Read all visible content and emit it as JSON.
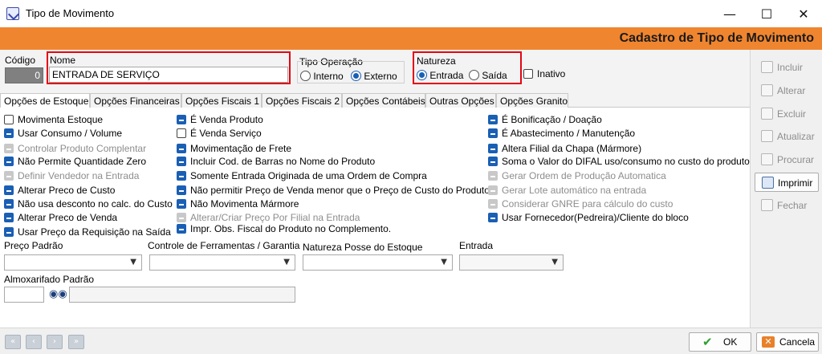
{
  "window": {
    "title": "Tipo de Movimento",
    "minimize": "—",
    "maximize": "☐",
    "close": "✕"
  },
  "header": {
    "title": "Cadastro de Tipo de Movimento"
  },
  "form": {
    "codigo_label": "Código",
    "codigo_value": "0",
    "nome_label": "Nome",
    "nome_value": "ENTRADA DE SERVIÇO",
    "tipo_operacao_label": "Tipo Operação",
    "interno": "Interno",
    "externo": "Externo",
    "natureza_label": "Natureza",
    "entrada": "Entrada",
    "saida": "Saída",
    "inativo": "Inativo"
  },
  "tabs": [
    "Opções de Estoque",
    "Opções Financeiras",
    "Opções Fiscais 1",
    "Opções Fiscais 2",
    "Opções Contábeis",
    "Outras Opções",
    "Opções Granito"
  ],
  "options_col1": [
    {
      "label": "Movimenta Estoque",
      "state": "unchecked"
    },
    {
      "label": "Usar Consumo / Volume",
      "state": "checked"
    },
    {
      "label": "Controlar Produto Complentar",
      "state": "disabled"
    },
    {
      "label": "Não Permite Quantidade Zero",
      "state": "checked"
    },
    {
      "label": "Definir Vendedor na Entrada",
      "state": "disabled"
    },
    {
      "label": "Alterar Preco de Custo",
      "state": "checked"
    },
    {
      "label": "Não usa desconto no calc. do Custo",
      "state": "checked"
    },
    {
      "label": "Alterar Preco de Venda",
      "state": "checked"
    },
    {
      "label": "Usar Preço da Requisição na Saída",
      "state": "checked"
    }
  ],
  "options_col2": [
    {
      "label": "É Venda Produto",
      "state": "checked"
    },
    {
      "label": "É Venda Serviço",
      "state": "unchecked"
    },
    {
      "label": "Movimentação de Frete",
      "state": "checked"
    },
    {
      "label": "Incluir Cod. de Barras no Nome do Produto",
      "state": "checked"
    },
    {
      "label": "Somente Entrada Originada de uma Ordem de Compra",
      "state": "checked"
    },
    {
      "label": "Não permitir Preço de Venda menor que o Preço de Custo do Produto",
      "state": "checked"
    },
    {
      "label": "Não Movimenta Mármore",
      "state": "checked"
    },
    {
      "label": "Alterar/Criar Preço Por Filial na Entrada",
      "state": "disabled"
    },
    {
      "label": "Impr. Obs. Fiscal do Produto no Complemento.",
      "state": "checked"
    }
  ],
  "options_col3": [
    {
      "label": "É Bonificação / Doação",
      "state": "checked"
    },
    {
      "label": "É Abastecimento / Manutenção",
      "state": "checked"
    },
    {
      "label": "Altera Filial da Chapa (Mármore)",
      "state": "checked"
    },
    {
      "label": "Soma o Valor do DIFAL uso/consumo no custo do produto",
      "state": "checked"
    },
    {
      "label": "Gerar Ordem de Produção Automatica",
      "state": "disabled"
    },
    {
      "label": "Gerar Lote automático na entrada",
      "state": "disabled"
    },
    {
      "label": "Considerar GNRE para cálculo do custo",
      "state": "disabled"
    },
    {
      "label": "Usar Fornecedor(Pedreira)/Cliente do bloco",
      "state": "checked"
    }
  ],
  "fields": {
    "preco_padrao": "Preço Padrão",
    "controle_ferramentas": "Controle de Ferramentas / Garantia",
    "natureza_posse": "Natureza Posse do Estoque",
    "entrada": "Entrada",
    "almoxarifado": "Almoxarifado Padrão"
  },
  "sidebar": [
    "Incluir",
    "Alterar",
    "Excluir",
    "Atualizar",
    "Procurar",
    "Imprimir",
    "Fechar"
  ],
  "bottom": {
    "ok": "OK",
    "cancel": "Cancela",
    "nav": [
      "«",
      "‹",
      "›",
      "»"
    ]
  },
  "colors": {
    "header_bg": "#f0852f",
    "accent": "#1a5fb4",
    "highlight": "#e30613"
  }
}
